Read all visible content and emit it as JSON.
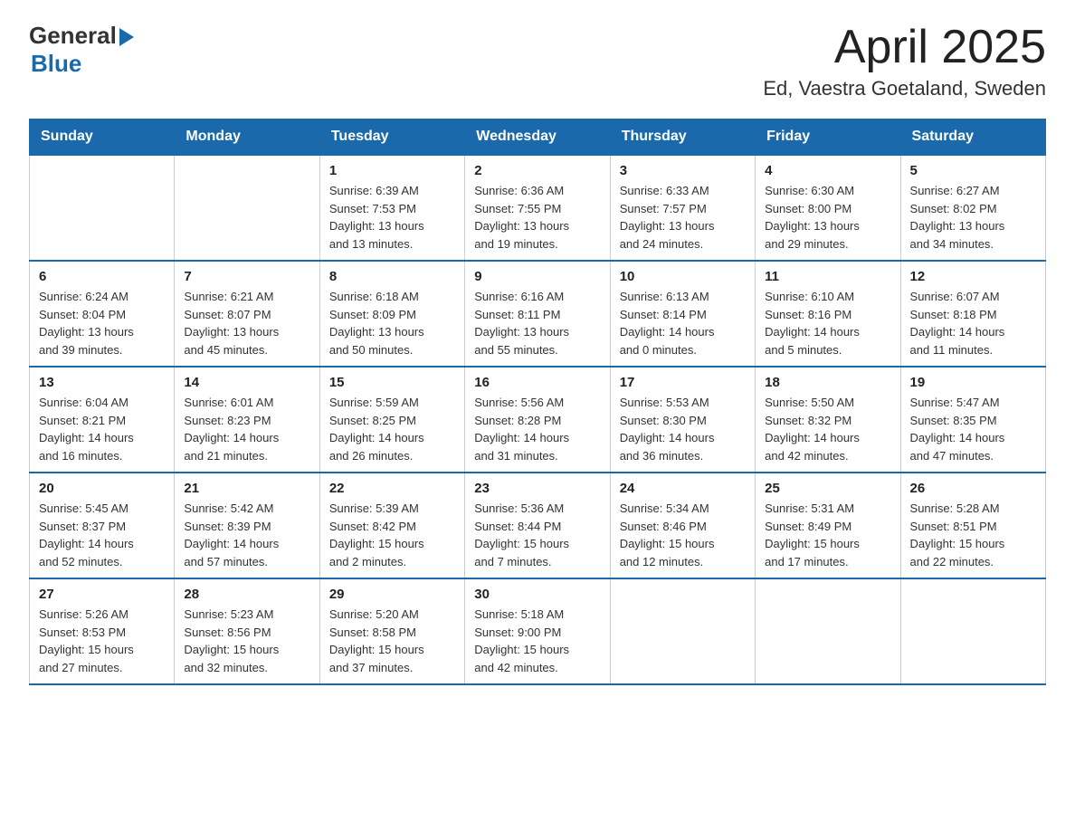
{
  "header": {
    "logo_general": "General",
    "logo_blue": "Blue",
    "title": "April 2025",
    "subtitle": "Ed, Vaestra Goetaland, Sweden"
  },
  "weekdays": [
    "Sunday",
    "Monday",
    "Tuesday",
    "Wednesday",
    "Thursday",
    "Friday",
    "Saturday"
  ],
  "weeks": [
    [
      {
        "day": "",
        "info": ""
      },
      {
        "day": "",
        "info": ""
      },
      {
        "day": "1",
        "info": "Sunrise: 6:39 AM\nSunset: 7:53 PM\nDaylight: 13 hours\nand 13 minutes."
      },
      {
        "day": "2",
        "info": "Sunrise: 6:36 AM\nSunset: 7:55 PM\nDaylight: 13 hours\nand 19 minutes."
      },
      {
        "day": "3",
        "info": "Sunrise: 6:33 AM\nSunset: 7:57 PM\nDaylight: 13 hours\nand 24 minutes."
      },
      {
        "day": "4",
        "info": "Sunrise: 6:30 AM\nSunset: 8:00 PM\nDaylight: 13 hours\nand 29 minutes."
      },
      {
        "day": "5",
        "info": "Sunrise: 6:27 AM\nSunset: 8:02 PM\nDaylight: 13 hours\nand 34 minutes."
      }
    ],
    [
      {
        "day": "6",
        "info": "Sunrise: 6:24 AM\nSunset: 8:04 PM\nDaylight: 13 hours\nand 39 minutes."
      },
      {
        "day": "7",
        "info": "Sunrise: 6:21 AM\nSunset: 8:07 PM\nDaylight: 13 hours\nand 45 minutes."
      },
      {
        "day": "8",
        "info": "Sunrise: 6:18 AM\nSunset: 8:09 PM\nDaylight: 13 hours\nand 50 minutes."
      },
      {
        "day": "9",
        "info": "Sunrise: 6:16 AM\nSunset: 8:11 PM\nDaylight: 13 hours\nand 55 minutes."
      },
      {
        "day": "10",
        "info": "Sunrise: 6:13 AM\nSunset: 8:14 PM\nDaylight: 14 hours\nand 0 minutes."
      },
      {
        "day": "11",
        "info": "Sunrise: 6:10 AM\nSunset: 8:16 PM\nDaylight: 14 hours\nand 5 minutes."
      },
      {
        "day": "12",
        "info": "Sunrise: 6:07 AM\nSunset: 8:18 PM\nDaylight: 14 hours\nand 11 minutes."
      }
    ],
    [
      {
        "day": "13",
        "info": "Sunrise: 6:04 AM\nSunset: 8:21 PM\nDaylight: 14 hours\nand 16 minutes."
      },
      {
        "day": "14",
        "info": "Sunrise: 6:01 AM\nSunset: 8:23 PM\nDaylight: 14 hours\nand 21 minutes."
      },
      {
        "day": "15",
        "info": "Sunrise: 5:59 AM\nSunset: 8:25 PM\nDaylight: 14 hours\nand 26 minutes."
      },
      {
        "day": "16",
        "info": "Sunrise: 5:56 AM\nSunset: 8:28 PM\nDaylight: 14 hours\nand 31 minutes."
      },
      {
        "day": "17",
        "info": "Sunrise: 5:53 AM\nSunset: 8:30 PM\nDaylight: 14 hours\nand 36 minutes."
      },
      {
        "day": "18",
        "info": "Sunrise: 5:50 AM\nSunset: 8:32 PM\nDaylight: 14 hours\nand 42 minutes."
      },
      {
        "day": "19",
        "info": "Sunrise: 5:47 AM\nSunset: 8:35 PM\nDaylight: 14 hours\nand 47 minutes."
      }
    ],
    [
      {
        "day": "20",
        "info": "Sunrise: 5:45 AM\nSunset: 8:37 PM\nDaylight: 14 hours\nand 52 minutes."
      },
      {
        "day": "21",
        "info": "Sunrise: 5:42 AM\nSunset: 8:39 PM\nDaylight: 14 hours\nand 57 minutes."
      },
      {
        "day": "22",
        "info": "Sunrise: 5:39 AM\nSunset: 8:42 PM\nDaylight: 15 hours\nand 2 minutes."
      },
      {
        "day": "23",
        "info": "Sunrise: 5:36 AM\nSunset: 8:44 PM\nDaylight: 15 hours\nand 7 minutes."
      },
      {
        "day": "24",
        "info": "Sunrise: 5:34 AM\nSunset: 8:46 PM\nDaylight: 15 hours\nand 12 minutes."
      },
      {
        "day": "25",
        "info": "Sunrise: 5:31 AM\nSunset: 8:49 PM\nDaylight: 15 hours\nand 17 minutes."
      },
      {
        "day": "26",
        "info": "Sunrise: 5:28 AM\nSunset: 8:51 PM\nDaylight: 15 hours\nand 22 minutes."
      }
    ],
    [
      {
        "day": "27",
        "info": "Sunrise: 5:26 AM\nSunset: 8:53 PM\nDaylight: 15 hours\nand 27 minutes."
      },
      {
        "day": "28",
        "info": "Sunrise: 5:23 AM\nSunset: 8:56 PM\nDaylight: 15 hours\nand 32 minutes."
      },
      {
        "day": "29",
        "info": "Sunrise: 5:20 AM\nSunset: 8:58 PM\nDaylight: 15 hours\nand 37 minutes."
      },
      {
        "day": "30",
        "info": "Sunrise: 5:18 AM\nSunset: 9:00 PM\nDaylight: 15 hours\nand 42 minutes."
      },
      {
        "day": "",
        "info": ""
      },
      {
        "day": "",
        "info": ""
      },
      {
        "day": "",
        "info": ""
      }
    ]
  ]
}
